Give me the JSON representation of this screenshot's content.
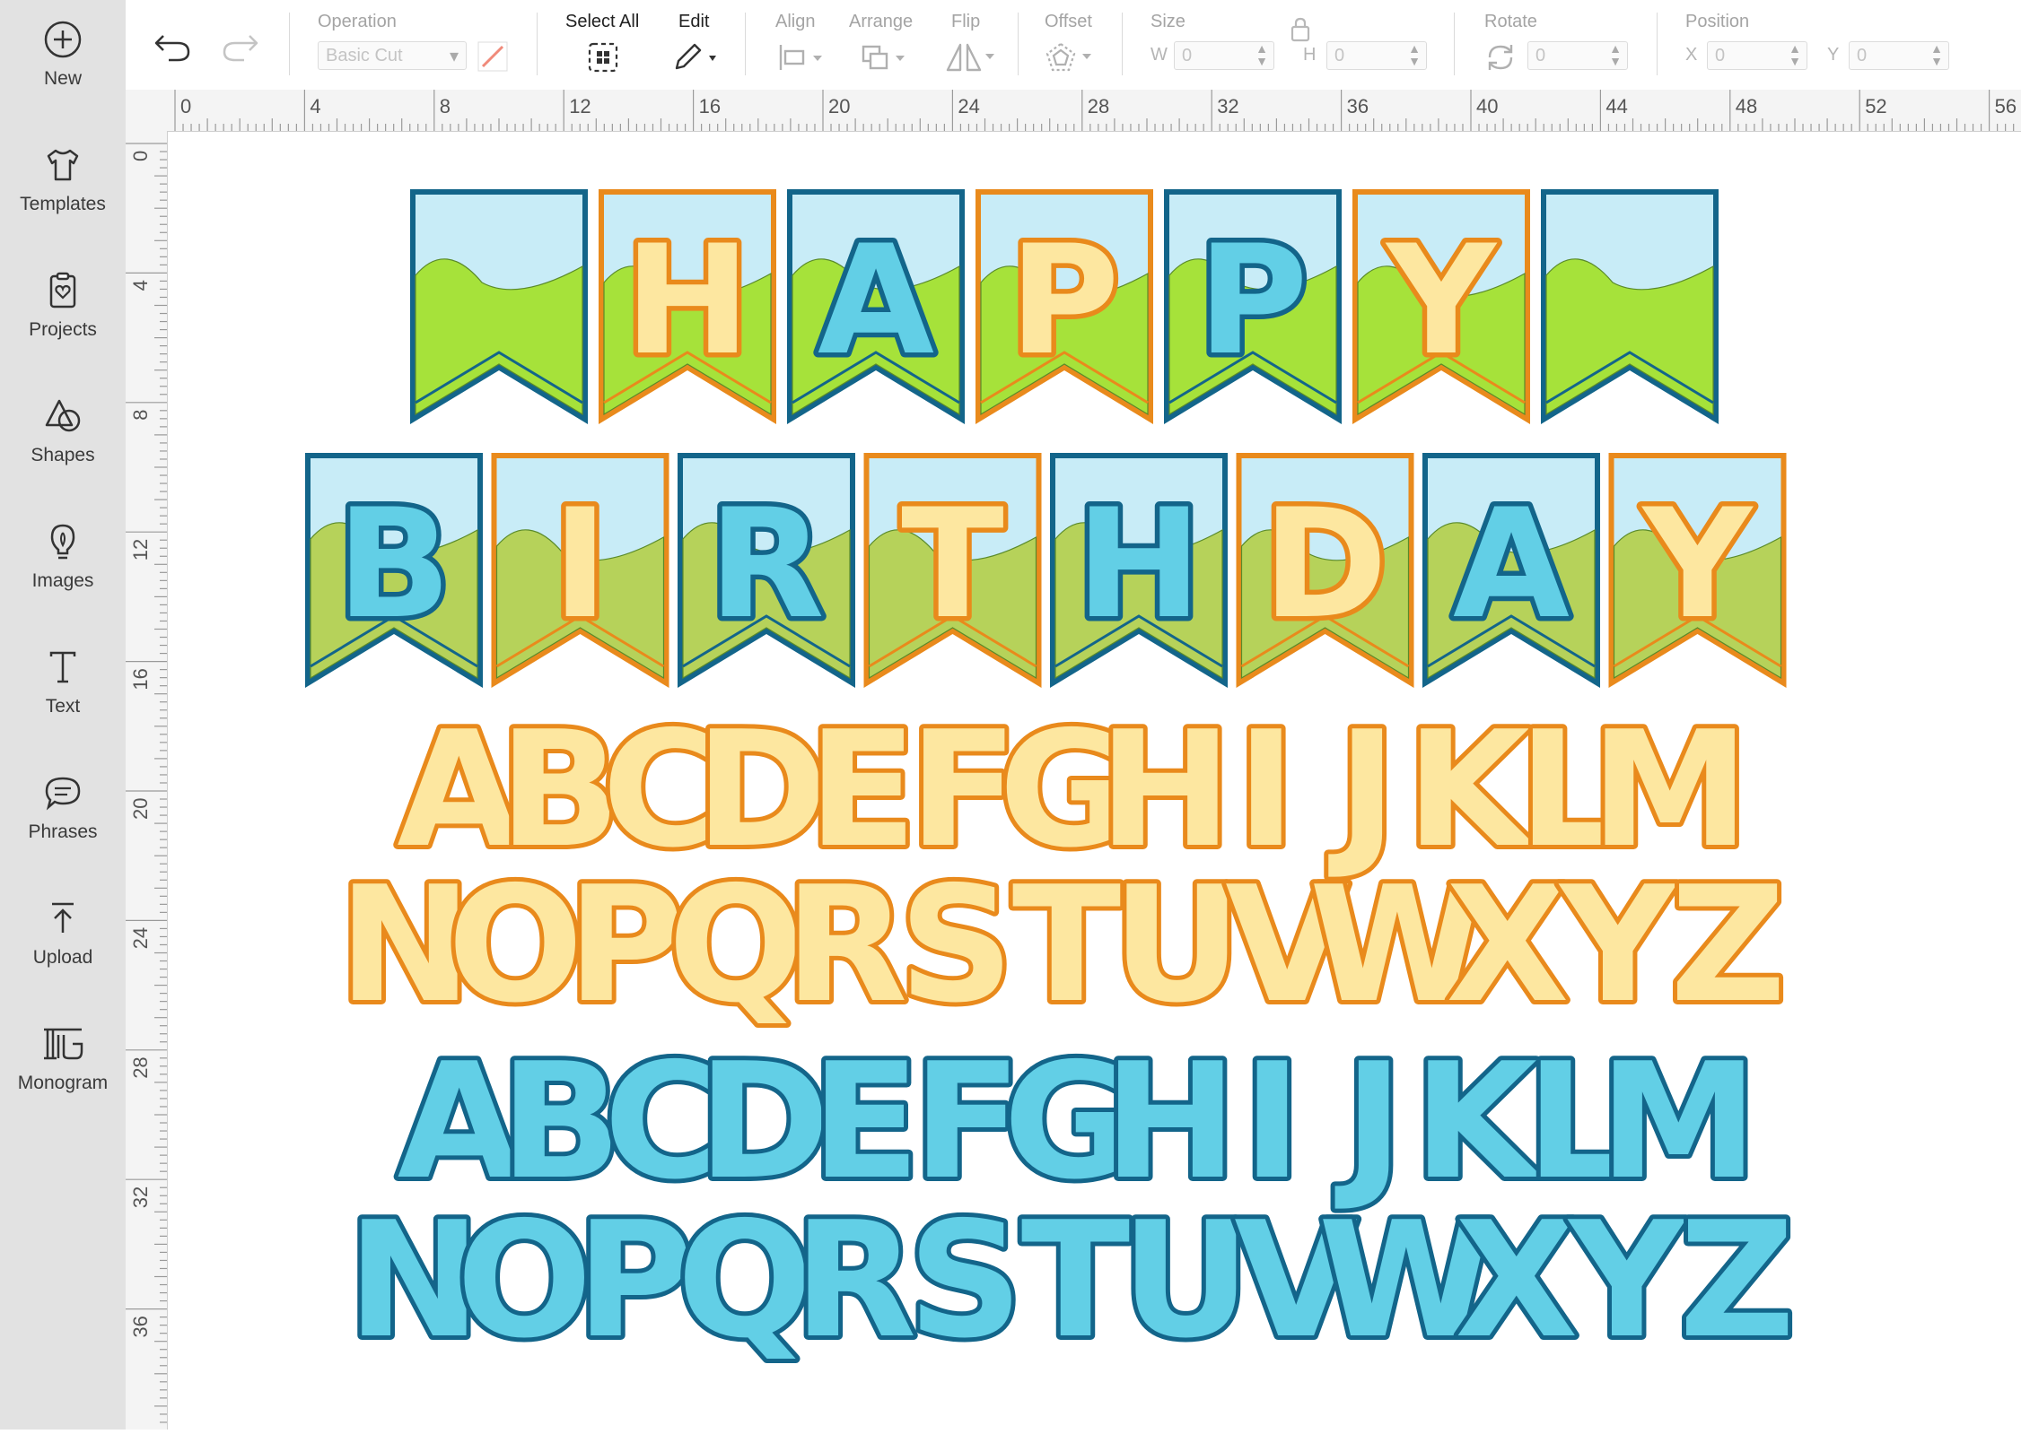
{
  "sidebar": {
    "items": [
      {
        "label": "New",
        "icon": "plus-circle-icon"
      },
      {
        "label": "Templates",
        "icon": "tshirt-icon"
      },
      {
        "label": "Projects",
        "icon": "clipboard-heart-icon"
      },
      {
        "label": "Shapes",
        "icon": "shapes-icon"
      },
      {
        "label": "Images",
        "icon": "lightbulb-icon"
      },
      {
        "label": "Text",
        "icon": "text-icon"
      },
      {
        "label": "Phrases",
        "icon": "chat-bubble-icon"
      },
      {
        "label": "Upload",
        "icon": "upload-icon"
      },
      {
        "label": "Monogram",
        "icon": "monogram-icon"
      }
    ]
  },
  "toolbar": {
    "undo_icon": "undo-icon",
    "redo_icon": "redo-icon",
    "operation_label": "Operation",
    "operation_value": "Basic Cut",
    "select_all_label": "Select All",
    "edit_label": "Edit",
    "align_label": "Align",
    "arrange_label": "Arrange",
    "flip_label": "Flip",
    "offset_label": "Offset",
    "size_label": "Size",
    "size_w_label": "W",
    "size_w_value": "0",
    "size_h_label": "H",
    "size_h_value": "0",
    "rotate_label": "Rotate",
    "rotate_value": "0",
    "position_label": "Position",
    "pos_x_label": "X",
    "pos_x_value": "0",
    "pos_y_label": "Y",
    "pos_y_value": "0"
  },
  "ruler": {
    "top_numbers": [
      "0",
      "4",
      "8",
      "12",
      "16",
      "20",
      "24",
      "28",
      "32",
      "36",
      "40",
      "44",
      "48",
      "52",
      "56"
    ],
    "left_numbers": [
      "0",
      "4",
      "8",
      "12",
      "16",
      "20",
      "24",
      "28",
      "32",
      "36"
    ]
  },
  "design": {
    "banner_row1_letters": [
      "",
      "H",
      "A",
      "P",
      "P",
      "Y",
      ""
    ],
    "banner_row2_letters": [
      "B",
      "I",
      "R",
      "T",
      "H",
      "D",
      "A",
      "Y"
    ],
    "alphabet_orange_row1": "ABCDEFGHIJKLM",
    "alphabet_orange_row2": "NOPQRSTUVWXYZ",
    "alphabet_blue_row1": "ABCDEFGHIJKLM",
    "alphabet_blue_row2": "NOPQRSTUVWXYZ",
    "colors": {
      "sky": "#c8ecf7",
      "grass_light": "#a6e23a",
      "grass_dark": "#b6d25a",
      "blue_border": "#13658a",
      "orange_border": "#e98a1c",
      "cream_fill": "#fde7a0",
      "blue_fill": "#62cfe6",
      "orange_hole": "#ef820b",
      "blue_hole": "#0f6e99"
    }
  }
}
